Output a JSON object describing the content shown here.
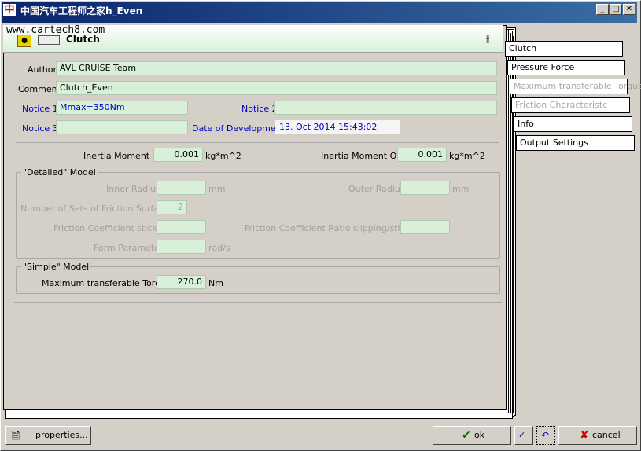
{
  "window": {
    "title": "中国汽车工程师之家h_Even",
    "watermark": "www.cartech8.com",
    "controls": {
      "minimize": "_",
      "maximize": "□",
      "close": "✕"
    }
  },
  "header": {
    "title": "Clutch"
  },
  "fields": {
    "author_label": "Author",
    "author_value": "AVL CRUISE Team",
    "comment_label": "Comment",
    "comment_value": "Clutch_Even",
    "notice1_label": "Notice 1",
    "notice1_value": "Mmax=350Nm",
    "notice2_label": "Notice 2",
    "notice2_value": "",
    "notice3_label": "Notice 3",
    "notice3_value": "",
    "date_label": "Date of Development",
    "date_value": "13. Oct 2014 15:43:02"
  },
  "inertia": {
    "in_label": "Inertia Moment In",
    "in_value": "0.001",
    "in_unit": "kg*m^2",
    "out_label": "Inertia Moment Out",
    "out_value": "0.001",
    "out_unit": "kg*m^2"
  },
  "detailed": {
    "title": "\"Detailed\" Model",
    "inner_radius_label": "Inner Radius",
    "inner_radius_value": "",
    "inner_radius_unit": "mm",
    "outer_radius_label": "Outer Radius",
    "outer_radius_value": "",
    "outer_radius_unit": "mm",
    "sets_label": "Number of Sets of Friction Surfaces",
    "sets_value": "2",
    "fc_sticking_label": "Friction Coefficient sticking",
    "fc_sticking_value": "",
    "fc_ratio_label": "Friction Coefficient Ratio slipping/sticking",
    "fc_ratio_value": "",
    "form_label": "Form Parameter",
    "form_value": "",
    "form_unit": "rad/s"
  },
  "simple": {
    "title": "\"Simple\" Model",
    "torque_label": "Maximum transferable Torque",
    "torque_value": "270.0",
    "torque_unit": "Nm"
  },
  "side_tabs": [
    {
      "label": "Clutch",
      "enabled": true
    },
    {
      "label": "Pressure Force",
      "enabled": true
    },
    {
      "label": "Maximum transferable Torque",
      "enabled": false
    },
    {
      "label": "Friction Characteristc",
      "enabled": false
    },
    {
      "label": "Info",
      "enabled": true
    },
    {
      "label": "Output Settings",
      "enabled": true
    }
  ],
  "bottom": {
    "properties_label": "properties...",
    "ok_label": "ok",
    "cancel_label": "cancel"
  },
  "colors": {
    "field_bg": "#d8efd8",
    "notice_text": "#0000c0",
    "title_bar": "#0a246a"
  }
}
